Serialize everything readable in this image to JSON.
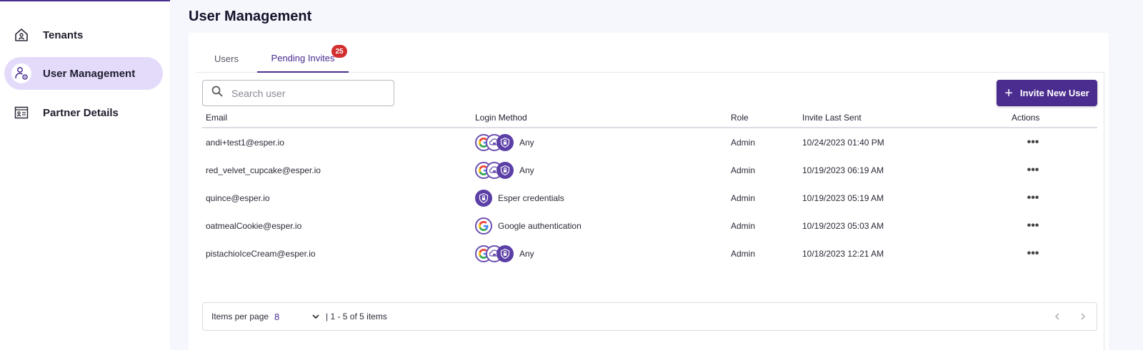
{
  "sidebar": {
    "items": [
      {
        "label": "Tenants",
        "icon": "house-icon",
        "active": false
      },
      {
        "label": "User Management",
        "icon": "user-gear-icon",
        "active": true
      },
      {
        "label": "Partner Details",
        "icon": "id-card-icon",
        "active": false
      }
    ]
  },
  "page": {
    "title": "User Management"
  },
  "tabs": [
    {
      "label": "Users",
      "active": false
    },
    {
      "label": "Pending Invites",
      "active": true,
      "badge": "25"
    }
  ],
  "search": {
    "placeholder": "Search user",
    "value": ""
  },
  "toolbar": {
    "invite_label": "Invite New User"
  },
  "table": {
    "columns": [
      "Email",
      "Login Method",
      "Role",
      "Invite Last Sent",
      "Actions"
    ],
    "rows": [
      {
        "email": "andi+test1@esper.io",
        "login_method": "Any",
        "login_icons": [
          "google-icon",
          "sso-icon",
          "esper-lock-icon"
        ],
        "role": "Admin",
        "sent": "10/24/2023 01:40 PM",
        "actions": "•••"
      },
      {
        "email": "red_velvet_cupcake@esper.io",
        "login_method": "Any",
        "login_icons": [
          "google-icon",
          "sso-icon",
          "esper-lock-icon"
        ],
        "role": "Admin",
        "sent": "10/19/2023 06:19 AM",
        "actions": "•••"
      },
      {
        "email": "quince@esper.io",
        "login_method": "Esper credentials",
        "login_icons": [
          "esper-lock-icon"
        ],
        "role": "Admin",
        "sent": "10/19/2023 05:19 AM",
        "actions": "•••"
      },
      {
        "email": "oatmealCookie@esper.io",
        "login_method": "Google authentication",
        "login_icons": [
          "google-icon"
        ],
        "role": "Admin",
        "sent": "10/19/2023 05:03 AM",
        "actions": "•••"
      },
      {
        "email": "pistachioIceCream@esper.io",
        "login_method": "Any",
        "login_icons": [
          "google-icon",
          "sso-icon",
          "esper-lock-icon"
        ],
        "role": "Admin",
        "sent": "10/18/2023 12:21 AM",
        "actions": "•••"
      }
    ]
  },
  "pagination": {
    "items_per_page_label": "Items per page",
    "items_per_page": "8",
    "summary": "| 1 - 5 of 5 items"
  },
  "colors": {
    "accent": "#4a2d8f",
    "active_nav_bg": "#e4dbfb",
    "badge": "#d32f2f"
  }
}
